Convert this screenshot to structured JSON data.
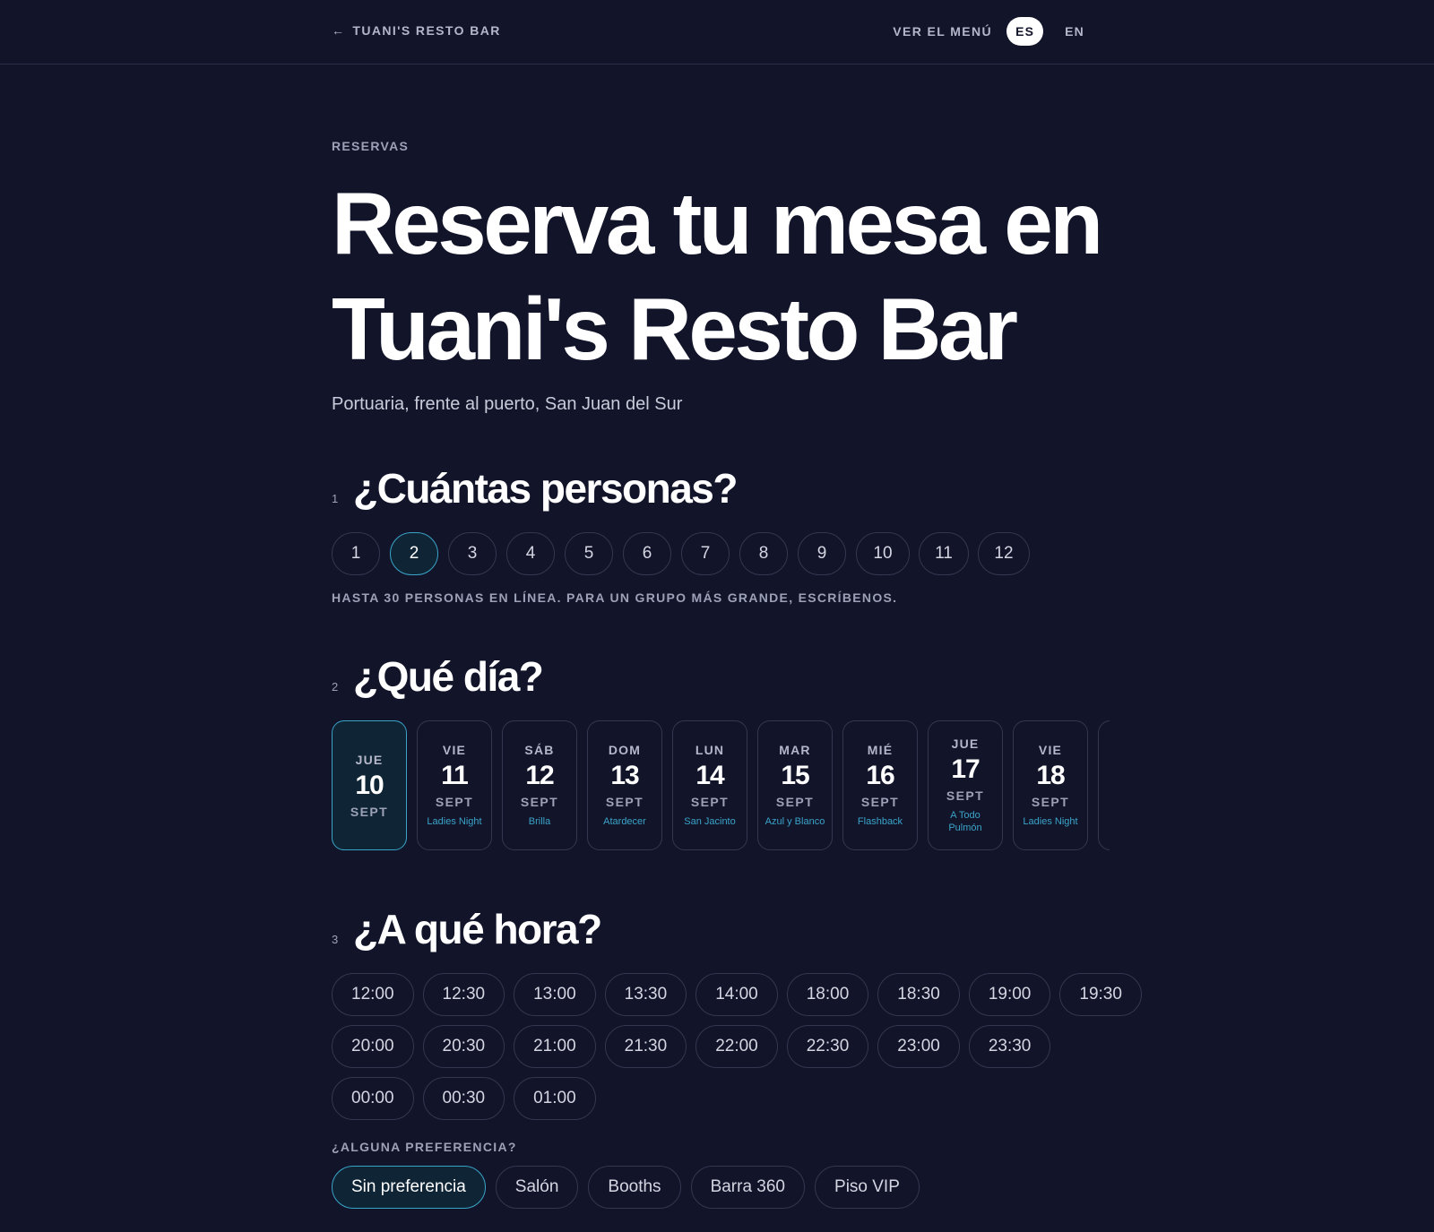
{
  "header": {
    "back_arrow": "←",
    "back_label": "TUANI'S RESTO BAR",
    "menu_label": "VER EL MENÚ",
    "languages": [
      {
        "label": "ES",
        "active": true
      },
      {
        "label": "EN",
        "active": false
      }
    ]
  },
  "hero": {
    "eyebrow": "RESERVAS",
    "title_line1": "Reserva tu mesa en",
    "title_line2": "Tuani's Resto Bar",
    "subtitle": "Portuaria, frente al puerto, San Juan del Sur"
  },
  "step1": {
    "number": "1",
    "title": "¿Cuántas personas?",
    "options": [
      "1",
      "2",
      "3",
      "4",
      "5",
      "6",
      "7",
      "8",
      "9",
      "10",
      "11",
      "12"
    ],
    "selected": "2",
    "note": "HASTA 30 PERSONAS EN LÍNEA. PARA UN GRUPO MÁS GRANDE, ESCRÍBENOS."
  },
  "step2": {
    "number": "2",
    "title": "¿Qué día?",
    "days": [
      {
        "weekday": "JUE",
        "day": "10",
        "month": "SEPT",
        "event": "",
        "selected": true
      },
      {
        "weekday": "VIE",
        "day": "11",
        "month": "SEPT",
        "event": "Ladies Night"
      },
      {
        "weekday": "SÁB",
        "day": "12",
        "month": "SEPT",
        "event": "Brilla"
      },
      {
        "weekday": "DOM",
        "day": "13",
        "month": "SEPT",
        "event": "Atardecer"
      },
      {
        "weekday": "LUN",
        "day": "14",
        "month": "SEPT",
        "event": "San Jacinto"
      },
      {
        "weekday": "MAR",
        "day": "15",
        "month": "SEPT",
        "event": "Azul y Blanco"
      },
      {
        "weekday": "MIÉ",
        "day": "16",
        "month": "SEPT",
        "event": "Flashback"
      },
      {
        "weekday": "JUE",
        "day": "17",
        "month": "SEPT",
        "event": "A Todo Pulmón"
      },
      {
        "weekday": "VIE",
        "day": "18",
        "month": "SEPT",
        "event": "Ladies Night"
      },
      {
        "weekday": "",
        "day": "",
        "month": "",
        "event": ""
      }
    ]
  },
  "step3": {
    "number": "3",
    "title": "¿A qué hora?",
    "time_rows": [
      [
        "12:00",
        "12:30",
        "13:00",
        "13:30",
        "14:00",
        "18:00",
        "18:30",
        "19:00",
        "19:30"
      ],
      [
        "20:00",
        "20:30",
        "21:00",
        "21:30",
        "22:00",
        "22:30",
        "23:00",
        "23:30"
      ],
      [
        "00:00",
        "00:30",
        "01:00"
      ]
    ]
  },
  "preference": {
    "label": "¿ALGUNA PREFERENCIA?",
    "options": [
      "Sin preferencia",
      "Salón",
      "Booths",
      "Barra 360",
      "Piso VIP"
    ],
    "selected": "Sin preferencia"
  },
  "colors": {
    "background": "#12142a",
    "accent": "#3aa4c8",
    "selected_fill": "#0f2535",
    "border": "#34374f",
    "muted_text": "#9da1b8"
  }
}
